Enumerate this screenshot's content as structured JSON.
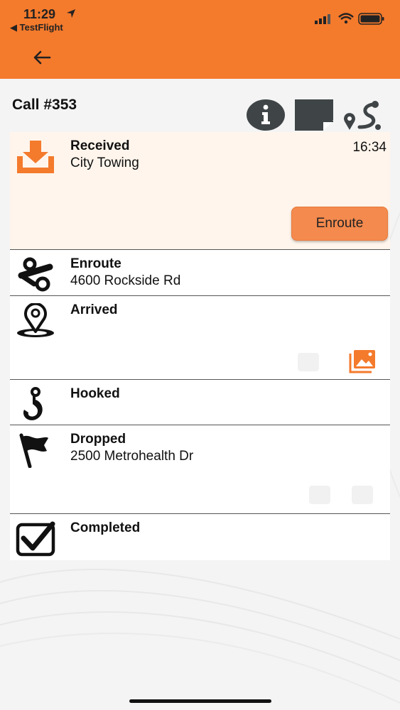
{
  "status_bar": {
    "time": "11:29",
    "back_app": "◀ TestFlight"
  },
  "page": {
    "title": "Call #353"
  },
  "steps": {
    "received": {
      "label": "Received",
      "sub": "City Towing",
      "time": "16:34",
      "action_label": "Enroute"
    },
    "enroute": {
      "label": "Enroute",
      "sub": "4600 Rockside Rd"
    },
    "arrived": {
      "label": "Arrived"
    },
    "hooked": {
      "label": "Hooked"
    },
    "dropped": {
      "label": "Dropped",
      "sub": "2500 Metrohealth Dr"
    },
    "completed": {
      "label": "Completed"
    }
  },
  "colors": {
    "accent": "#f47a2c",
    "icon_dark": "#3f4547",
    "received_bg": "#fff5ec"
  },
  "icons": [
    "back-arrow-icon",
    "info-icon",
    "note-icon",
    "route-icon",
    "download-icon",
    "tow-truck-icon",
    "map-pin-icon",
    "hook-icon",
    "flag-icon",
    "checkbox-icon",
    "photos-icon"
  ]
}
